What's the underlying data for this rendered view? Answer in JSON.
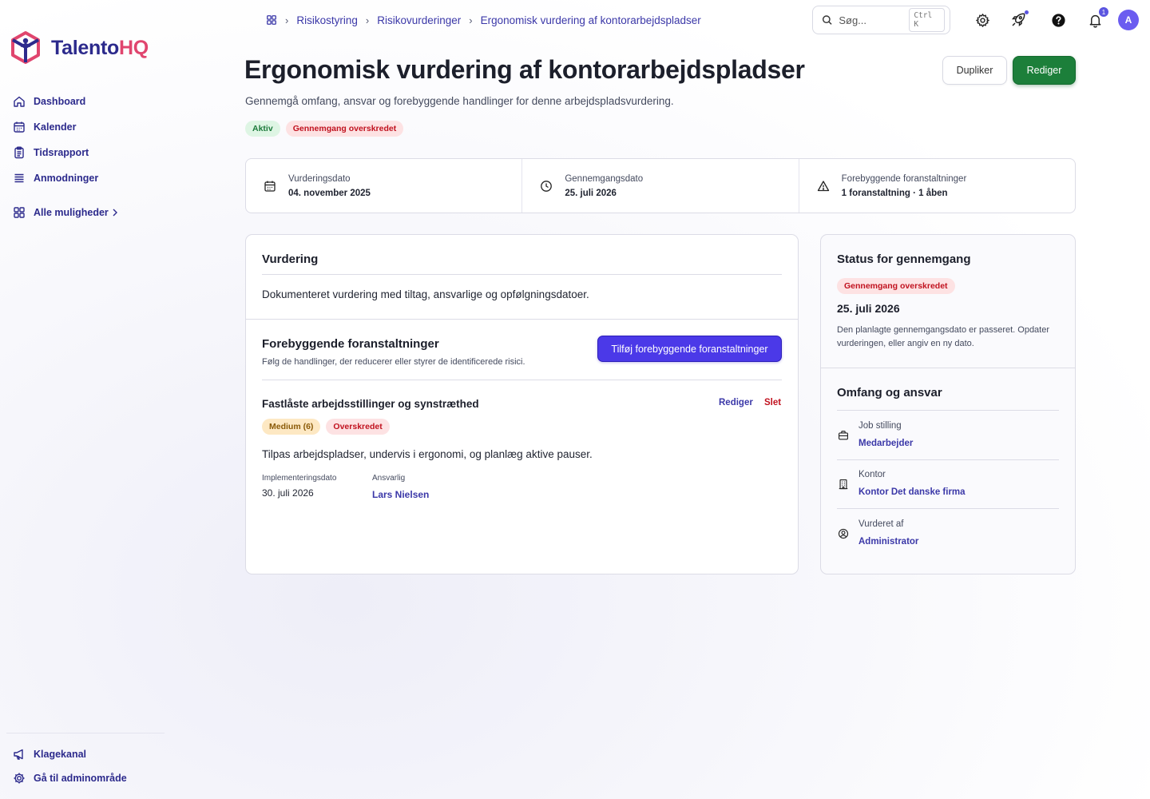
{
  "brand": {
    "name_part1": "Talento",
    "name_part2": "HQ"
  },
  "sidebar": {
    "items": [
      {
        "label": "Dashboard",
        "icon": "home-icon"
      },
      {
        "label": "Kalender",
        "icon": "calendar-icon"
      },
      {
        "label": "Tidsrapport",
        "icon": "clipboard-icon"
      },
      {
        "label": "Anmodninger",
        "icon": "list-icon"
      }
    ],
    "more": {
      "label": "Alle muligheder",
      "icon": "grid-icon"
    },
    "footer": [
      {
        "label": "Klagekanal",
        "icon": "megaphone-icon"
      },
      {
        "label": "Gå til adminområde",
        "icon": "gear-icon"
      }
    ]
  },
  "breadcrumb": [
    "Risikostyring",
    "Risikovurderinger",
    "Ergonomisk vurdering af kontorarbejdspladser"
  ],
  "search": {
    "placeholder": "Søg...",
    "shortcut": "Ctrl K"
  },
  "topbar": {
    "notification_count": "1",
    "avatar_initial": "A"
  },
  "header": {
    "title": "Ergonomisk vurdering af kontorarbejdspladser",
    "subtitle": "Gennemgå omfang, ansvar og forebyggende handlinger for denne arbejdspladsvurdering.",
    "badges": [
      "Aktiv",
      "Gennemgang overskredet"
    ],
    "duplicate_label": "Dupliker",
    "edit_label": "Rediger"
  },
  "stats": [
    {
      "label": "Vurderingsdato",
      "value": "04. november 2025",
      "icon": "calendar-icon"
    },
    {
      "label": "Gennemgangsdato",
      "value": "25. juli 2026",
      "icon": "clock-icon"
    },
    {
      "label": "Forebyggende foranstaltninger",
      "value": "1 foranstaltning · 1 åben",
      "icon": "warning-icon"
    }
  ],
  "assessment": {
    "title": "Vurdering",
    "description": "Dokumenteret vurdering med tiltag, ansvarlige og opfølgningsdatoer."
  },
  "preventive": {
    "title": "Forebyggende foranstaltninger",
    "subtitle": "Følg de handlinger, der reducerer eller styrer de identificerede risici.",
    "add_label": "Tilføj forebyggende foranstaltninger",
    "item": {
      "title": "Fastlåste arbejdsstillinger og synstræthed",
      "edit_label": "Rediger",
      "delete_label": "Slet",
      "badges": [
        "Medium (6)",
        "Overskredet"
      ],
      "description": "Tilpas arbejdspladser, undervis i ergonomi, og planlæg aktive pauser.",
      "impl_label": "Implementeringsdato",
      "impl_value": "30. juli 2026",
      "owner_label": "Ansvarlig",
      "owner_value": "Lars Nielsen"
    }
  },
  "review_status": {
    "title": "Status for gennemgang",
    "badge": "Gennemgang overskredet",
    "date": "25. juli 2026",
    "note": "Den planlagte gennemgangsdato er passeret. Opdater vurderingen, eller angiv en ny dato."
  },
  "scope": {
    "title": "Omfang og ansvar",
    "rows": [
      {
        "label": "Job stilling",
        "value": "Medarbejder",
        "icon": "briefcase-icon"
      },
      {
        "label": "Kontor",
        "value": "Kontor Det danske firma",
        "icon": "building-icon"
      },
      {
        "label": "Vurderet af",
        "value": "Administrator",
        "icon": "user-circle-icon"
      }
    ]
  },
  "colors": {
    "primary": "#2c2a8c",
    "accent": "#e0456e",
    "success": "#1c7f3a",
    "danger": "#c1121f",
    "action": "#4b39e8"
  }
}
